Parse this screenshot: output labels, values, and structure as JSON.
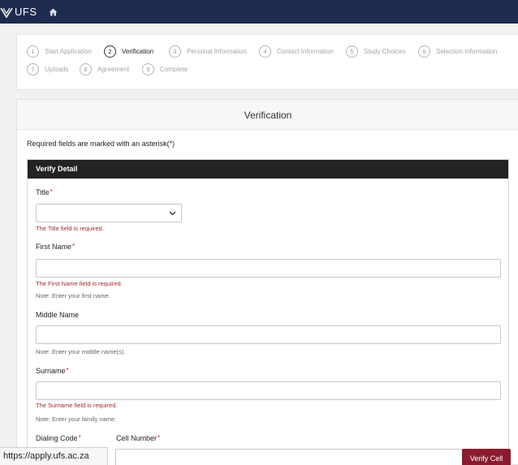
{
  "header": {
    "logo_text": "UFS",
    "colors": {
      "bar": "#1d2b4f"
    }
  },
  "steps": [
    {
      "num": "1",
      "label": "Start Application",
      "active": false
    },
    {
      "num": "2",
      "label": "Verification",
      "active": true
    },
    {
      "num": "3",
      "label": "Personal Information",
      "active": false
    },
    {
      "num": "4",
      "label": "Contact Information",
      "active": false
    },
    {
      "num": "5",
      "label": "Study Choices",
      "active": false
    },
    {
      "num": "6",
      "label": "Selection Information",
      "active": false
    },
    {
      "num": "7",
      "label": "Uploads",
      "active": false
    },
    {
      "num": "8",
      "label": "Agreement",
      "active": false
    },
    {
      "num": "9",
      "label": "Complete",
      "active": false
    }
  ],
  "page": {
    "title": "Verification",
    "required_note": "Required fields are marked with an asterisk(*)"
  },
  "card": {
    "header": "Verify Detail",
    "title_field": {
      "label": "Title",
      "asterisk": "*",
      "value": "",
      "error": "The Title field is required."
    },
    "first_name": {
      "label": "First Name",
      "asterisk": "*",
      "value": "",
      "error": "The First Name field is required.",
      "note": "Note: Enter your first name."
    },
    "middle_name": {
      "label": "Middle Name",
      "value": "",
      "note": "Note: Enter your middle name(s)."
    },
    "surname": {
      "label": "Surname",
      "asterisk": "*",
      "value": "",
      "error": "The Surname field is required.",
      "note": "Note: Enter your family name."
    },
    "dialing_code": {
      "label": "Dialing Code",
      "asterisk": "*"
    },
    "cell_number": {
      "label": "Cell Number",
      "asterisk": "*",
      "value": ""
    },
    "verify_button": "Verify Cell"
  },
  "status_bar": {
    "url": "https://apply.ufs.ac.za"
  },
  "colors": {
    "accent": "#8a1b2f",
    "error": "#9e2a2a",
    "asterisk": "#c42a2a"
  }
}
